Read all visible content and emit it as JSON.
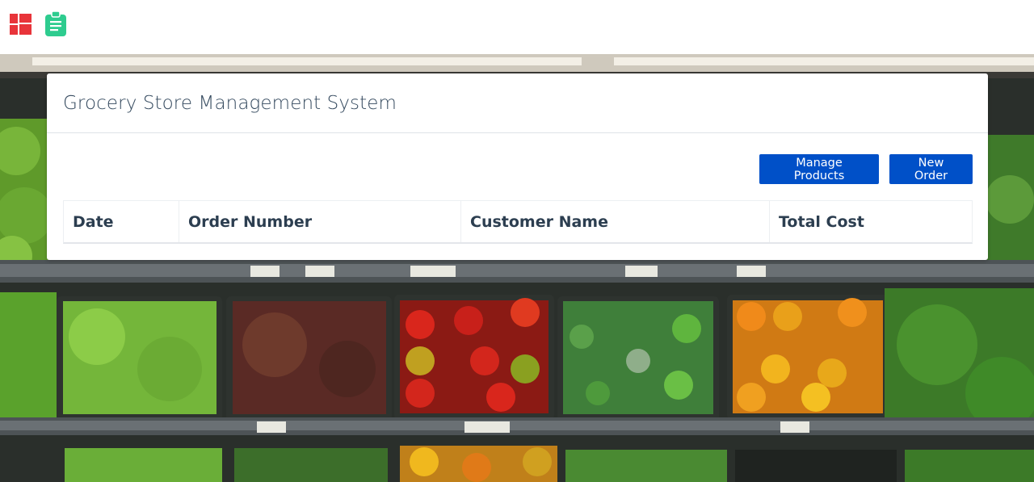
{
  "navbar": {
    "logo_icon": "grid-logo-icon",
    "nav_icon": "clipboard-icon",
    "colors": {
      "logo": "#e8343a",
      "clipboard": "#2ecc8f"
    }
  },
  "card": {
    "title": "Grocery Store Management System",
    "buttons": {
      "manage_products": "Manage Products",
      "new_order": "New Order"
    },
    "table": {
      "columns": [
        "Date",
        "Order Number",
        "Customer Name",
        "Total Cost"
      ],
      "rows": []
    }
  },
  "colors": {
    "button": "#0050c8",
    "title": "#34495e",
    "header_text": "#2c3e50"
  }
}
